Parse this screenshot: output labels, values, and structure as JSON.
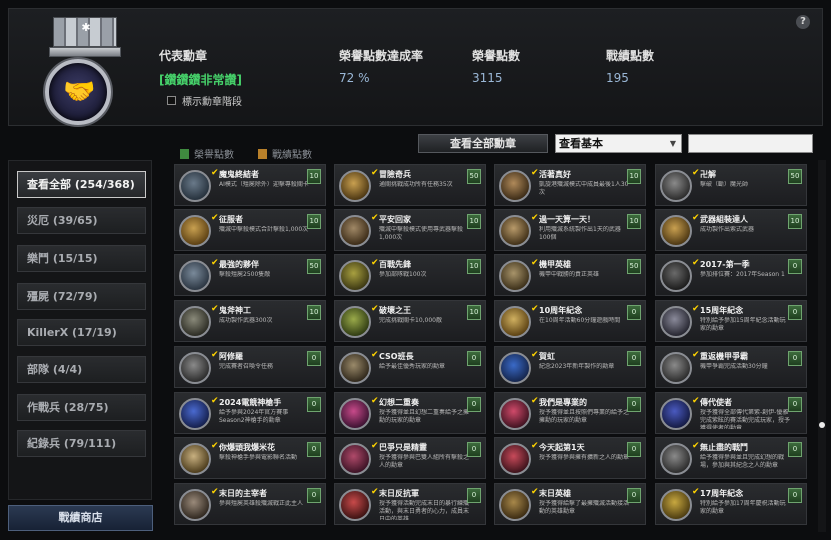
{
  "header": {
    "label_rep": "代表勳章",
    "rep_value": "[鑽鑽鑽非常讚]",
    "label_rate": "榮譽點數達成率",
    "rate_value": "72 %",
    "label_honor": "榮譽點數",
    "honor_value": "3115",
    "label_record": "戰績點數",
    "record_value": "195",
    "show_level": "標示勳章階段",
    "help": "?"
  },
  "toolbar": {
    "legend_honor": "榮譽點數",
    "legend_record": "戰績點數",
    "view_all": "查看全部勳章",
    "select_value": "查看基本",
    "honor_color": "#3f8a3f",
    "record_color": "#b8802a"
  },
  "sidebar": {
    "items": [
      {
        "label": "查看全部 (254/368)"
      },
      {
        "label": "災厄 (39/65)"
      },
      {
        "label": "樂鬥 (15/15)"
      },
      {
        "label": "殭屍 (72/79)"
      },
      {
        "label": "KillerX (17/19)"
      },
      {
        "label": "部隊 (4/4)"
      },
      {
        "label": "作戰兵 (28/75)"
      },
      {
        "label": "紀錄兵 (79/111)"
      }
    ],
    "shop": "戰績商店"
  },
  "medals": [
    {
      "name": "魔鬼終結者",
      "desc": "AI模式（殭屍除外）迎擊專殺關卡",
      "pts": "10",
      "c1": "#6a7a8a",
      "c2": "#25303b"
    },
    {
      "name": "冒險奇兵",
      "desc": "通關挑戰成功所有任務35次",
      "pts": "50",
      "c1": "#c9a050",
      "c2": "#4a3512"
    },
    {
      "name": "活著真好",
      "desc": "凱旋港殲滅模式中成員最後1人30次",
      "pts": "10",
      "c1": "#b08a5a",
      "c2": "#3a2a16"
    },
    {
      "name": "卍解",
      "desc": "擊破（斷）魔光師",
      "pts": "50",
      "c1": "#8a8a8a",
      "c2": "#2a2a2a"
    },
    {
      "name": "征服者",
      "desc": "殲滅中擊殺模式合計擊殺1,000次",
      "pts": "10",
      "c1": "#c8a050",
      "c2": "#5a3e12"
    },
    {
      "name": "平安回家",
      "desc": "殲滅中擊殺模式使用專武器擊殺1,000次",
      "pts": "10",
      "c1": "#a08866",
      "c2": "#3a2a16"
    },
    {
      "name": "過一天算一天！",
      "desc": "利用殲滅系統製作出1天的武器100個",
      "pts": "10",
      "c1": "#b89a6a",
      "c2": "#3e2e16"
    },
    {
      "name": "武器組裝達人",
      "desc": "成功製作出索式武器",
      "pts": "10",
      "c1": "#c9a050",
      "c2": "#4a3512"
    },
    {
      "name": "最強的夥伴",
      "desc": "擊殺殭屍2500隻敵",
      "pts": "50",
      "c1": "#7a8a9a",
      "c2": "#2a3440"
    },
    {
      "name": "百戰先鋒",
      "desc": "參加部隊戰100次",
      "pts": "10",
      "c1": "#a8a040",
      "c2": "#3a3612"
    },
    {
      "name": "機甲英雄",
      "desc": "機甲中戰勝的貢正英雄",
      "pts": "50",
      "c1": "#a8946a",
      "c2": "#3a2e18"
    },
    {
      "name": "2017-第一季",
      "desc": "參加排位賽：2017年Season 1",
      "pts": "0",
      "c1": "#6a6a6a",
      "c2": "#1a1a1a"
    },
    {
      "name": "鬼斧神工",
      "desc": "成功製作武器300次",
      "pts": "10",
      "c1": "#8a8a7a",
      "c2": "#2a2a22"
    },
    {
      "name": "破壞之王",
      "desc": "完成挑戰關卡10,000敵",
      "pts": "10",
      "c1": "#9aaa4a",
      "c2": "#2e3a12"
    },
    {
      "name": "10周年紀念",
      "desc": "在10周年活動60分鐘遊戲時間",
      "pts": "0",
      "c1": "#d0b060",
      "c2": "#5a4012"
    },
    {
      "name": "15周年紀念",
      "desc": "特別給予參加15周年紀念活動玩家的勳章",
      "pts": "0",
      "c1": "#8a8a9a",
      "c2": "#24242e"
    },
    {
      "name": "阿修羅",
      "desc": "完成賽者召喚令任務",
      "pts": "0",
      "c1": "#8a8a8a",
      "c2": "#2a2a2a"
    },
    {
      "name": "CSO班長",
      "desc": "給予最佳優秀玩家的勳章",
      "pts": "0",
      "c1": "#9a8a6a",
      "c2": "#2e261a"
    },
    {
      "name": "賀虹",
      "desc": "紀念2023年新年製作的勳章",
      "pts": "0",
      "c1": "#3a6ac8",
      "c2": "#14244a"
    },
    {
      "name": "重返機甲爭霸",
      "desc": "機甲爭霸完成活動30分鐘",
      "pts": "0",
      "c1": "#8a8a8a",
      "c2": "#2a2a2a"
    },
    {
      "name": "2024電競神槍手",
      "desc": "給予參與2024年官方賽事Season2神槍手的勳章",
      "pts": "0",
      "c1": "#4a6ad0",
      "c2": "#141e4a"
    },
    {
      "name": "幻想二重奏",
      "desc": "授予獲得並且幻想二重奏給予之擁勳的玩家的勳章",
      "pts": "0",
      "c1": "#c84a8a",
      "c2": "#3a1230"
    },
    {
      "name": "我們是專業的",
      "desc": "授予獲得並且按照們專業的給予之擁勳的玩家的勳章",
      "pts": "0",
      "c1": "#d04a6a",
      "c2": "#3e1220"
    },
    {
      "name": "傳代使者",
      "desc": "授予獲得全部傳代第紫-創伊-優雅完成紫眩的賽活動完成玩家，授予獲得使者的勳章",
      "pts": "0",
      "c1": "#4a5ac0",
      "c2": "#141a42"
    },
    {
      "name": "你爆頭我爆米花",
      "desc": "擊殺神槍手參與電影聯名活動",
      "pts": "0",
      "c1": "#c8b080",
      "c2": "#4a3a1a"
    },
    {
      "name": "巴爭只是精靈",
      "desc": "授予獲得參與巴雙人組所有擊殺之人的勳章",
      "pts": "0",
      "c1": "#b04a6a",
      "c2": "#3a1224"
    },
    {
      "name": "今天起第1天",
      "desc": "授予獲得參與擁有擴新之人的勳章",
      "pts": "0",
      "c1": "#c84a5a",
      "c2": "#3a121a"
    },
    {
      "name": "無止盡的戰鬥",
      "desc": "給予獲得參與並且完成幻想的戰場，參加與其紀念之人的勳章",
      "pts": "0",
      "c1": "#8a8a8a",
      "c2": "#2a2a2a"
    },
    {
      "name": "末日的主宰者",
      "desc": "參與殭屍英雄殺殲滅戰正此主人",
      "pts": "0",
      "c1": "#9a8a7a",
      "c2": "#2e261e"
    },
    {
      "name": "末日反抗軍",
      "desc": "授予獲得活動完成末日的暴行練殲活動，與末日勇者的心力，成員末日中的英雄",
      "pts": "0",
      "c1": "#c84a4a",
      "c2": "#3a1212"
    },
    {
      "name": "末日英雄",
      "desc": "授予獲得給擊了最擁殲滅活動接活動的英雄勳章",
      "pts": "0",
      "c1": "#a8884a",
      "c2": "#3a2a12"
    },
    {
      "name": "17周年紀念",
      "desc": "特別給予參加17周年慶祝活動玩家的勳章",
      "pts": "0",
      "c1": "#c8a840",
      "c2": "#4a3a10"
    }
  ]
}
